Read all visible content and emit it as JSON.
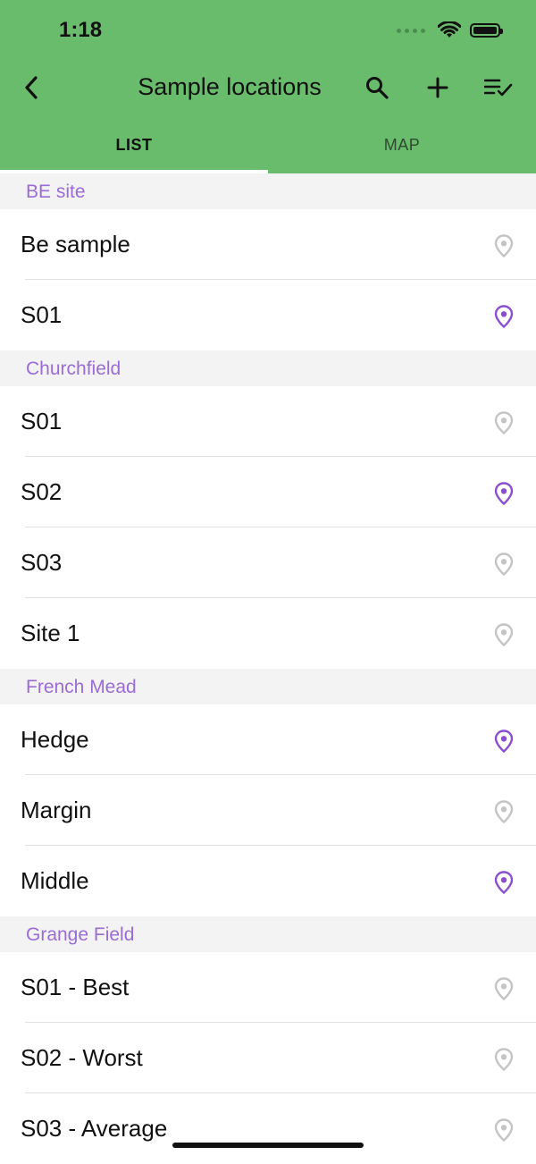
{
  "status_bar": {
    "time": "1:18"
  },
  "nav": {
    "title": "Sample locations"
  },
  "tabs": [
    {
      "label": "LIST",
      "active": true
    },
    {
      "label": "MAP",
      "active": false
    }
  ],
  "colors": {
    "header": "#69bc6c",
    "accent_purple": "#8a4fd1",
    "pin_gray": "#c4c4c4",
    "section_text": "#9b6cd6"
  },
  "sections": [
    {
      "title": "BE site",
      "items": [
        {
          "label": "Be sample",
          "pin": "gray"
        },
        {
          "label": "S01",
          "pin": "purple"
        }
      ]
    },
    {
      "title": "Churchfield",
      "items": [
        {
          "label": "S01",
          "pin": "gray"
        },
        {
          "label": "S02",
          "pin": "purple"
        },
        {
          "label": "S03",
          "pin": "gray"
        },
        {
          "label": "Site 1",
          "pin": "gray"
        }
      ]
    },
    {
      "title": "French Mead",
      "items": [
        {
          "label": "Hedge",
          "pin": "purple"
        },
        {
          "label": "Margin",
          "pin": "gray"
        },
        {
          "label": "Middle",
          "pin": "purple"
        }
      ]
    },
    {
      "title": "Grange Field",
      "items": [
        {
          "label": "S01 - Best",
          "pin": "gray"
        },
        {
          "label": "S02 - Worst",
          "pin": "gray"
        },
        {
          "label": "S03 - Average",
          "pin": "gray"
        }
      ]
    }
  ]
}
